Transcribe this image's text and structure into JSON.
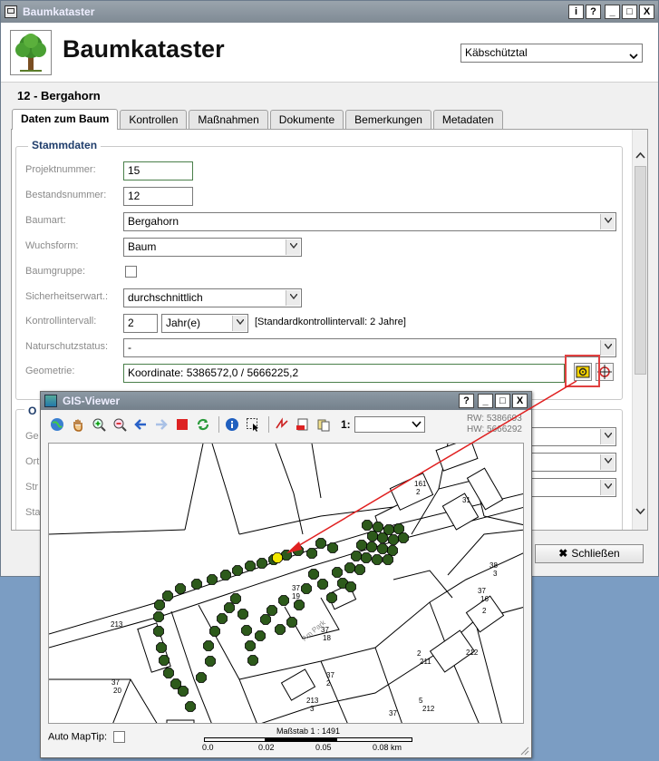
{
  "window": {
    "title": "Baumkataster",
    "buttons": [
      "i",
      "?",
      "_",
      "□",
      "X"
    ]
  },
  "app": {
    "title": "Baumkataster",
    "region": "Käbschütztal"
  },
  "record": {
    "title": "12 - Bergahorn"
  },
  "tabs": [
    "Daten zum Baum",
    "Kontrollen",
    "Maßnahmen",
    "Dokumente",
    "Bemerkungen",
    "Metadaten"
  ],
  "stammdaten": {
    "legend": "Stammdaten",
    "projektnummer": {
      "label": "Projektnummer:",
      "value": "15"
    },
    "bestandsnummer": {
      "label": "Bestandsnummer:",
      "value": "12"
    },
    "baumart": {
      "label": "Baumart:",
      "value": "Bergahorn"
    },
    "wuchsform": {
      "label": "Wuchsform:",
      "value": "Baum"
    },
    "baumgruppe": {
      "label": "Baumgruppe:"
    },
    "sicherheit": {
      "label": "Sicherheitserwart.:",
      "value": "durchschnittlich"
    },
    "kontroll": {
      "label": "Kontrollintervall:",
      "value": "2",
      "unit": "Jahr(e)",
      "hint": "[Standardkontrollintervall: 2 Jahre]"
    },
    "natur": {
      "label": "Naturschutzstatus:",
      "value": "-"
    },
    "geometrie": {
      "label": "Geometrie:",
      "value": "Koordinate: 5386572,0 / 5666225,2"
    }
  },
  "ort": {
    "legend": "O",
    "labels": [
      "Ge",
      "Ort",
      "Str",
      "Sta"
    ]
  },
  "close_label": "Schließen",
  "gis": {
    "title": "GIS-Viewer",
    "buttons": [
      "?",
      "_",
      "□",
      "X"
    ],
    "scale_label": "1:",
    "rw": "RW: 5386693",
    "hw": "HW: 5666292",
    "auto_maptip": "Auto MapTip:",
    "scalebar": {
      "title": "Maßstab 1 : 1491",
      "ticks": [
        "0.0",
        "0.02",
        "0.05",
        "0.08 km"
      ]
    },
    "map_street": "Am Park",
    "parcels": [
      "161",
      "2",
      "31",
      "37",
      "19",
      "37",
      "18",
      "37",
      "2",
      "213",
      "3",
      "38",
      "3",
      "37",
      "16",
      "37",
      "20",
      "213",
      "2",
      "211",
      "212",
      "5",
      "212",
      "37",
      "2"
    ]
  },
  "colors": {
    "tree": "#2d5a1b",
    "tree_selected": "#f2e800",
    "highlight": "#e03030"
  }
}
